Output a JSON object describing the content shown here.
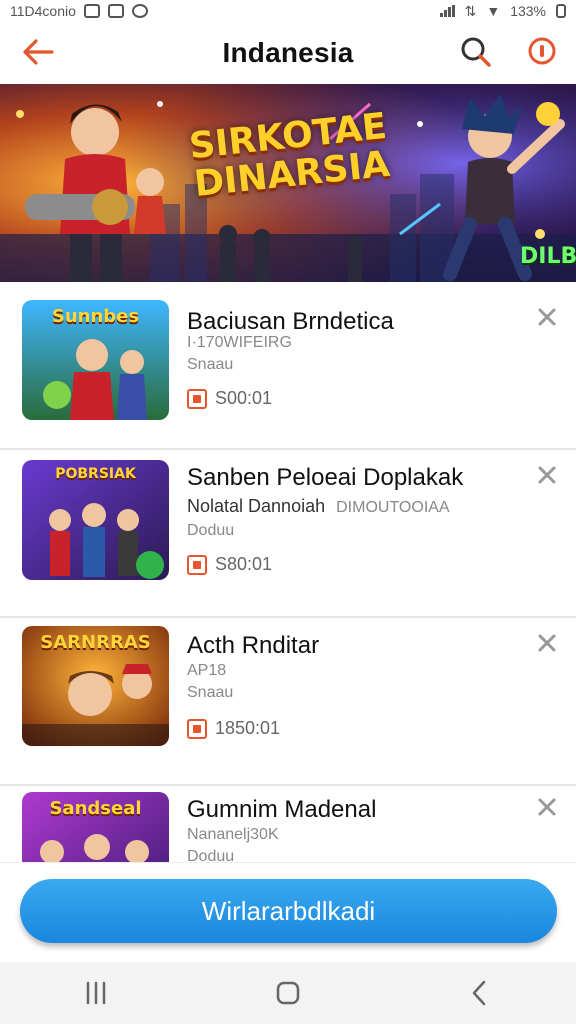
{
  "status_bar": {
    "left_text": "11D4conio",
    "right_text": "133%"
  },
  "app_bar": {
    "title": "Indanesia",
    "icons": [
      "back-arrow-icon",
      "search-icon",
      "more-icon"
    ],
    "accent_color": "#e4572e"
  },
  "banner": {
    "title_line1": "SIRKOTAE",
    "title_line2": "DINARSIA",
    "badge": "DILB"
  },
  "items": [
    {
      "thumb_label": "Sunnbes",
      "title": "Baciusan Brndetica",
      "subtitle": "I·170WIFEIRG",
      "subtitle2": "Snaau",
      "price": "S00:01"
    },
    {
      "thumb_label": "POBRSIAK",
      "title": "Sanben Peloeai Doplakak",
      "subtitle": "Nolatal Dannoiah",
      "subtitle_tag": "DIMOUTOOIAA",
      "subtitle2": "Doduu",
      "price": "S80:01"
    },
    {
      "thumb_label": "SARNRRAS",
      "title": "Acth Rnditar",
      "subtitle": "AP18",
      "subtitle2": "Snaau",
      "price": "1850:01"
    },
    {
      "thumb_label": "Sandseal",
      "title": "Gumnim Madenal",
      "subtitle": "Nananelj30K",
      "subtitle2": "Doduu",
      "price": ""
    }
  ],
  "cta": {
    "label": "Wirlararbdlkadi",
    "color": "#1a86dd"
  },
  "nav_bar": {
    "icons": [
      "recents-icon",
      "home-icon",
      "back-icon"
    ]
  }
}
